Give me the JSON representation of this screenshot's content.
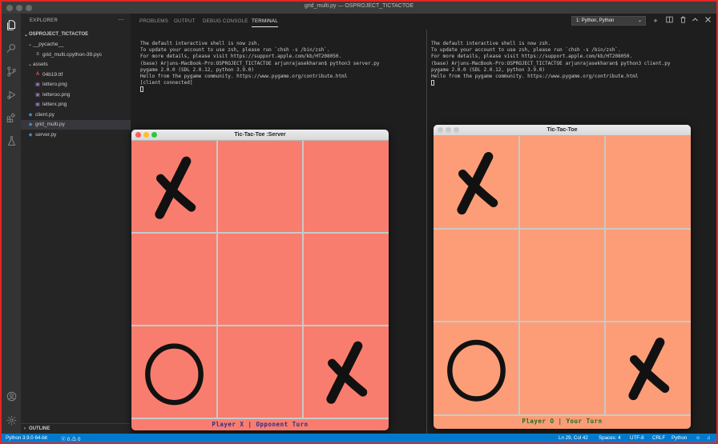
{
  "window": {
    "title": "grid_multi.py — OSPROJECT_TICTACTOE"
  },
  "activity_bar": {
    "icons": [
      "files-icon",
      "search-icon",
      "source-control-icon",
      "run-debug-icon",
      "extensions-icon",
      "testing-icon",
      "account-icon",
      "settings-gear-icon"
    ]
  },
  "sidebar": {
    "title": "EXPLORER",
    "more": "···",
    "items": [
      {
        "label": "OSPROJECT_TICTACTOE",
        "type": "root"
      },
      {
        "label": "__pycache__",
        "type": "folder"
      },
      {
        "label": "grid_multi.cpython-39.pyc",
        "type": "pyc"
      },
      {
        "label": "assets",
        "type": "folder"
      },
      {
        "label": "04b19.ttf",
        "type": "font"
      },
      {
        "label": "lettero.png",
        "type": "image"
      },
      {
        "label": "letteroo.png",
        "type": "image"
      },
      {
        "label": "letterx.png",
        "type": "image"
      },
      {
        "label": "client.py",
        "type": "python"
      },
      {
        "label": "grid_multi.py",
        "type": "python"
      },
      {
        "label": "server.py",
        "type": "python"
      }
    ],
    "outline_label": "OUTLINE"
  },
  "panel": {
    "tabs": [
      "PROBLEMS",
      "OUTPUT",
      "DEBUG CONSOLE",
      "TERMINAL"
    ],
    "active_tab": "TERMINAL",
    "terminal_select": "1: Python, Python"
  },
  "terminal_left": {
    "lines": [
      "The default interactive shell is now zsh.",
      "To update your account to use zsh, please run `chsh -s /bin/zsh`.",
      "For more details, please visit https://support.apple.com/kb/HT208050.",
      "(base) Arjuns-MacBook-Pro:OSPROJECT_TICTACTOE arjunrajasekharan$ python3 server.py",
      "pygame 2.0.0 (SDL 2.0.12, python 3.9.0)",
      "Hello from the pygame community. https://www.pygame.org/contribute.html",
      "[client connected]"
    ]
  },
  "terminal_right": {
    "lines": [
      "The default interactive shell is now zsh.",
      "To update your account to use zsh, please run `chsh -s /bin/zsh`.",
      "For more details, please visit https://support.apple.com/kb/HT208050.",
      "(base) Arjuns-MacBook-Pro:OSPROJECT_TICTACTOE arjunrajasekharan$ python3 client.py",
      "pygame 2.0.0 (SDL 2.0.12, python 3.9.0)",
      "Hello from the pygame community. https://www.pygame.org/contribute.html"
    ]
  },
  "server_game": {
    "title": "Tic-Tac-Toe :Server",
    "board": [
      "X",
      "",
      "",
      "",
      "",
      "",
      "O",
      "",
      "X"
    ],
    "status": "Player X | Opponent Turn",
    "bg_color": "#f97d6e",
    "status_color": "#2c2c8c"
  },
  "client_game": {
    "title": "Tic-Tac-Toe",
    "board": [
      "X",
      "",
      "",
      "",
      "",
      "",
      "O",
      "",
      "X"
    ],
    "status": "Player O | Your Turn",
    "bg_color": "#fc9d77",
    "status_color": "#1e6e1e"
  },
  "status_bar": {
    "python": "Python 3.9.0 64-bit",
    "problems": "0",
    "warnings": "0",
    "position": "Ln 29, Col 42",
    "spaces": "Spaces: 4",
    "encoding": "UTF-8",
    "eol": "CRLF",
    "language": "Python",
    "color": "#007acc"
  }
}
